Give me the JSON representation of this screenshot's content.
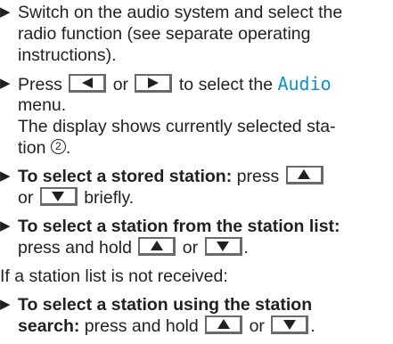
{
  "bullet_symbol": "▶",
  "step1": {
    "line1": "Switch on the audio system and select the",
    "line2": "radio function (see separate operating",
    "line3": "instructions)."
  },
  "step2": {
    "press": "Press",
    "or": "or",
    "to_select": "to select the",
    "menu_name": "Audio",
    "menu_word": "menu.",
    "display_line1": "The display shows currently selected sta-",
    "display_line2_prefix": "tion",
    "callout": "2",
    "display_line2_suffix": "."
  },
  "step3": {
    "bold": "To select a stored station:",
    "text": "press",
    "or": "or",
    "briefly": "briefly."
  },
  "step4": {
    "bold": "To select a station from the station list:",
    "text": "press and hold",
    "or": "or",
    "end": "."
  },
  "note": "If a station list is not received:",
  "step5": {
    "bold_line1": "To select a station using the station",
    "bold_line2": "search:",
    "text": "press and hold",
    "or": "or",
    "end": "."
  },
  "keys": {
    "left": "left-arrow-key",
    "right": "right-arrow-key",
    "up": "up-arrow-key",
    "down": "down-arrow-key"
  },
  "colors": {
    "text": "#231f20",
    "display_text": "#0b8fd4",
    "key_border": "#6a6a6a"
  }
}
